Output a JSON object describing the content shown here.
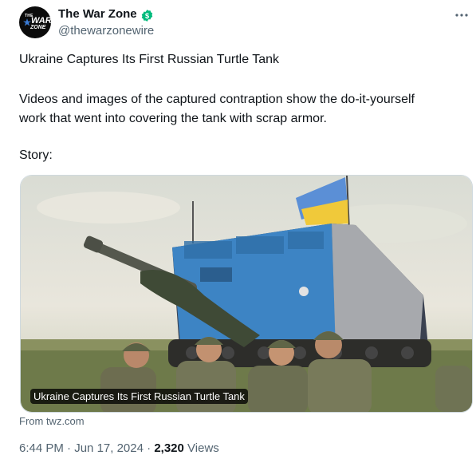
{
  "account": {
    "display_name": "The War Zone",
    "handle": "@thewarzonewire",
    "avatar_logo": {
      "top": "THE",
      "mid": "WAR",
      "bottom": "ZONE"
    }
  },
  "tweet": {
    "title": "Ukraine Captures Its First Russian Turtle Tank",
    "body_line1": "Videos and images of the captured contraption show the do-it-yourself",
    "body_line2": "work that went into covering the tank with scrap armor.",
    "story_label": "Story:"
  },
  "card": {
    "caption": "Ukraine Captures Its First Russian Turtle Tank",
    "source": "From twz.com"
  },
  "meta": {
    "time": "6:44 PM",
    "separator": "·",
    "date": "Jun 17, 2024",
    "views_count": "2,320",
    "views_label": "Views"
  },
  "colors": {
    "verified_badge": "#00ba7c",
    "secondary_text": "#536471",
    "primary_text": "#0f1419"
  },
  "icons": {
    "verified": "verified-badge-icon",
    "more": "more-horizontal-icon"
  }
}
